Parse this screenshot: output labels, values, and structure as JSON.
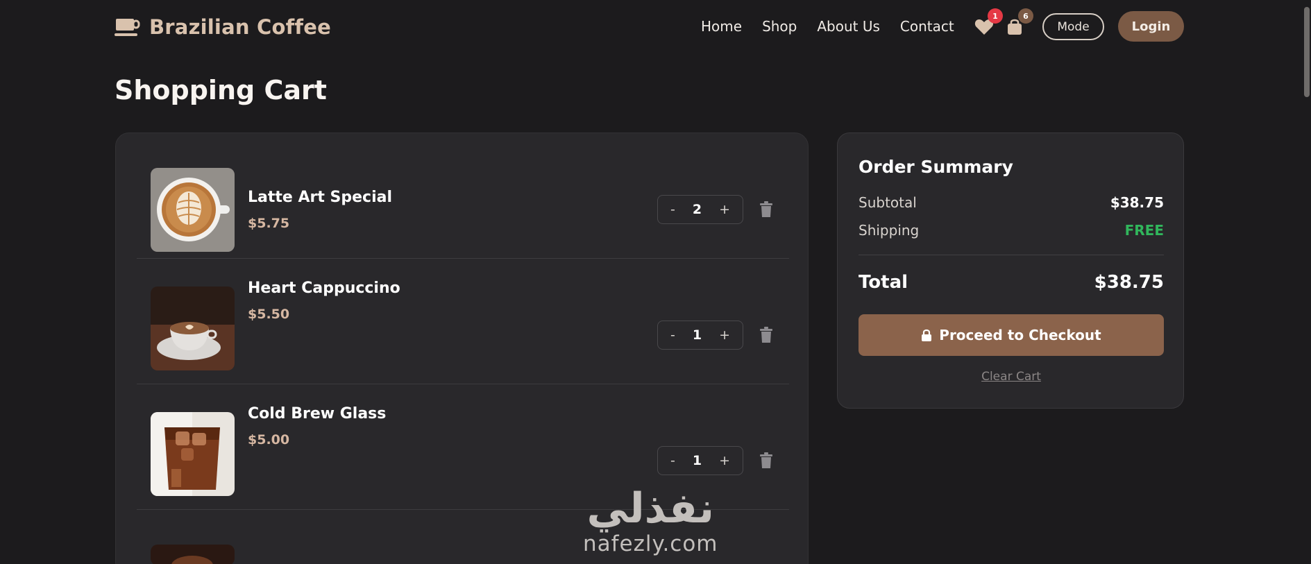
{
  "brand": {
    "name": "Brazilian Coffee",
    "icon": "coffee-cup-icon",
    "color": "#d9c2ad"
  },
  "nav": {
    "items": [
      "Home",
      "Shop",
      "About Us",
      "Contact"
    ]
  },
  "header": {
    "wishlist_count": "1",
    "cart_count": "6",
    "mode_label": "Mode",
    "login_label": "Login"
  },
  "page": {
    "title": "Shopping Cart"
  },
  "cart": {
    "items": [
      {
        "name": "Latte Art Special",
        "price": "$5.75",
        "qty": "2"
      },
      {
        "name": "Heart Cappuccino",
        "price": "$5.50",
        "qty": "1"
      },
      {
        "name": "Cold Brew Glass",
        "price": "$5.00",
        "qty": "1"
      }
    ],
    "minus_label": "-",
    "plus_label": "+"
  },
  "summary": {
    "title": "Order Summary",
    "subtotal_label": "Subtotal",
    "subtotal_value": "$38.75",
    "shipping_label": "Shipping",
    "shipping_value": "FREE",
    "total_label": "Total",
    "total_value": "$38.75",
    "checkout_label": "Proceed to Checkout",
    "clear_label": "Clear Cart"
  },
  "watermark": {
    "arabic": "نفذلي",
    "latin": "nafezly.com"
  },
  "colors": {
    "accent": "#8b634b",
    "login": "#7b5a45",
    "price": "#d6b7a2",
    "free": "#31b65c",
    "wishlist_badge": "#e53945",
    "cart_badge": "#7b5a45"
  }
}
